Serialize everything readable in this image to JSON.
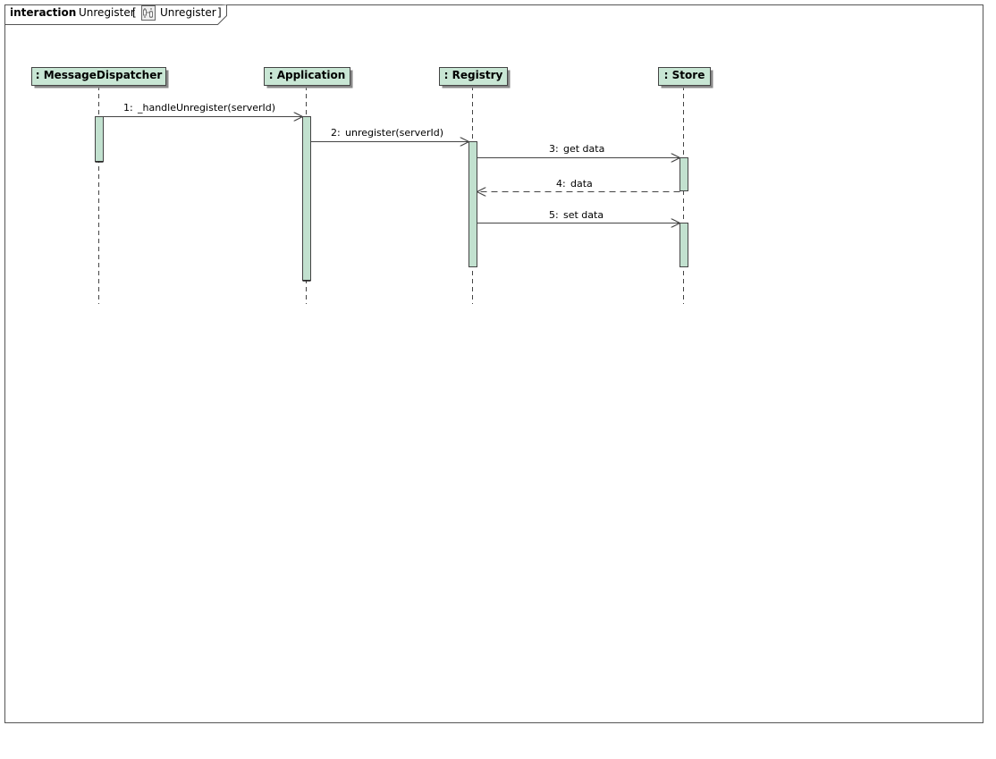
{
  "frame": {
    "keyword": "interaction",
    "name": "Unregister",
    "open_bracket": "[",
    "ref_icon": "sequence-diagram-icon",
    "ref_name": "Unregister",
    "close_bracket": "]"
  },
  "lifelines": [
    {
      "id": "dispatcher",
      "label": ": MessageDispatcher"
    },
    {
      "id": "application",
      "label": ": Application"
    },
    {
      "id": "registry",
      "label": ": Registry"
    },
    {
      "id": "store",
      "label": ": Store"
    }
  ],
  "messages": [
    {
      "number": "1:",
      "text": "_handleUnregister(serverId)",
      "from": "dispatcher",
      "to": "application",
      "kind": "sync"
    },
    {
      "number": "2:",
      "text": "unregister(serverId)",
      "from": "application",
      "to": "registry",
      "kind": "sync"
    },
    {
      "number": "3:",
      "text": "get data",
      "from": "registry",
      "to": "store",
      "kind": "sync"
    },
    {
      "number": "4:",
      "text": "data",
      "from": "store",
      "to": "registry",
      "kind": "reply"
    },
    {
      "number": "5:",
      "text": "set data",
      "from": "registry",
      "to": "store",
      "kind": "sync"
    }
  ],
  "colors": {
    "head_fill": "#c8e6d4",
    "activation_fill": "#c2e1cf",
    "line": "#444444",
    "frame_line": "#555555"
  }
}
